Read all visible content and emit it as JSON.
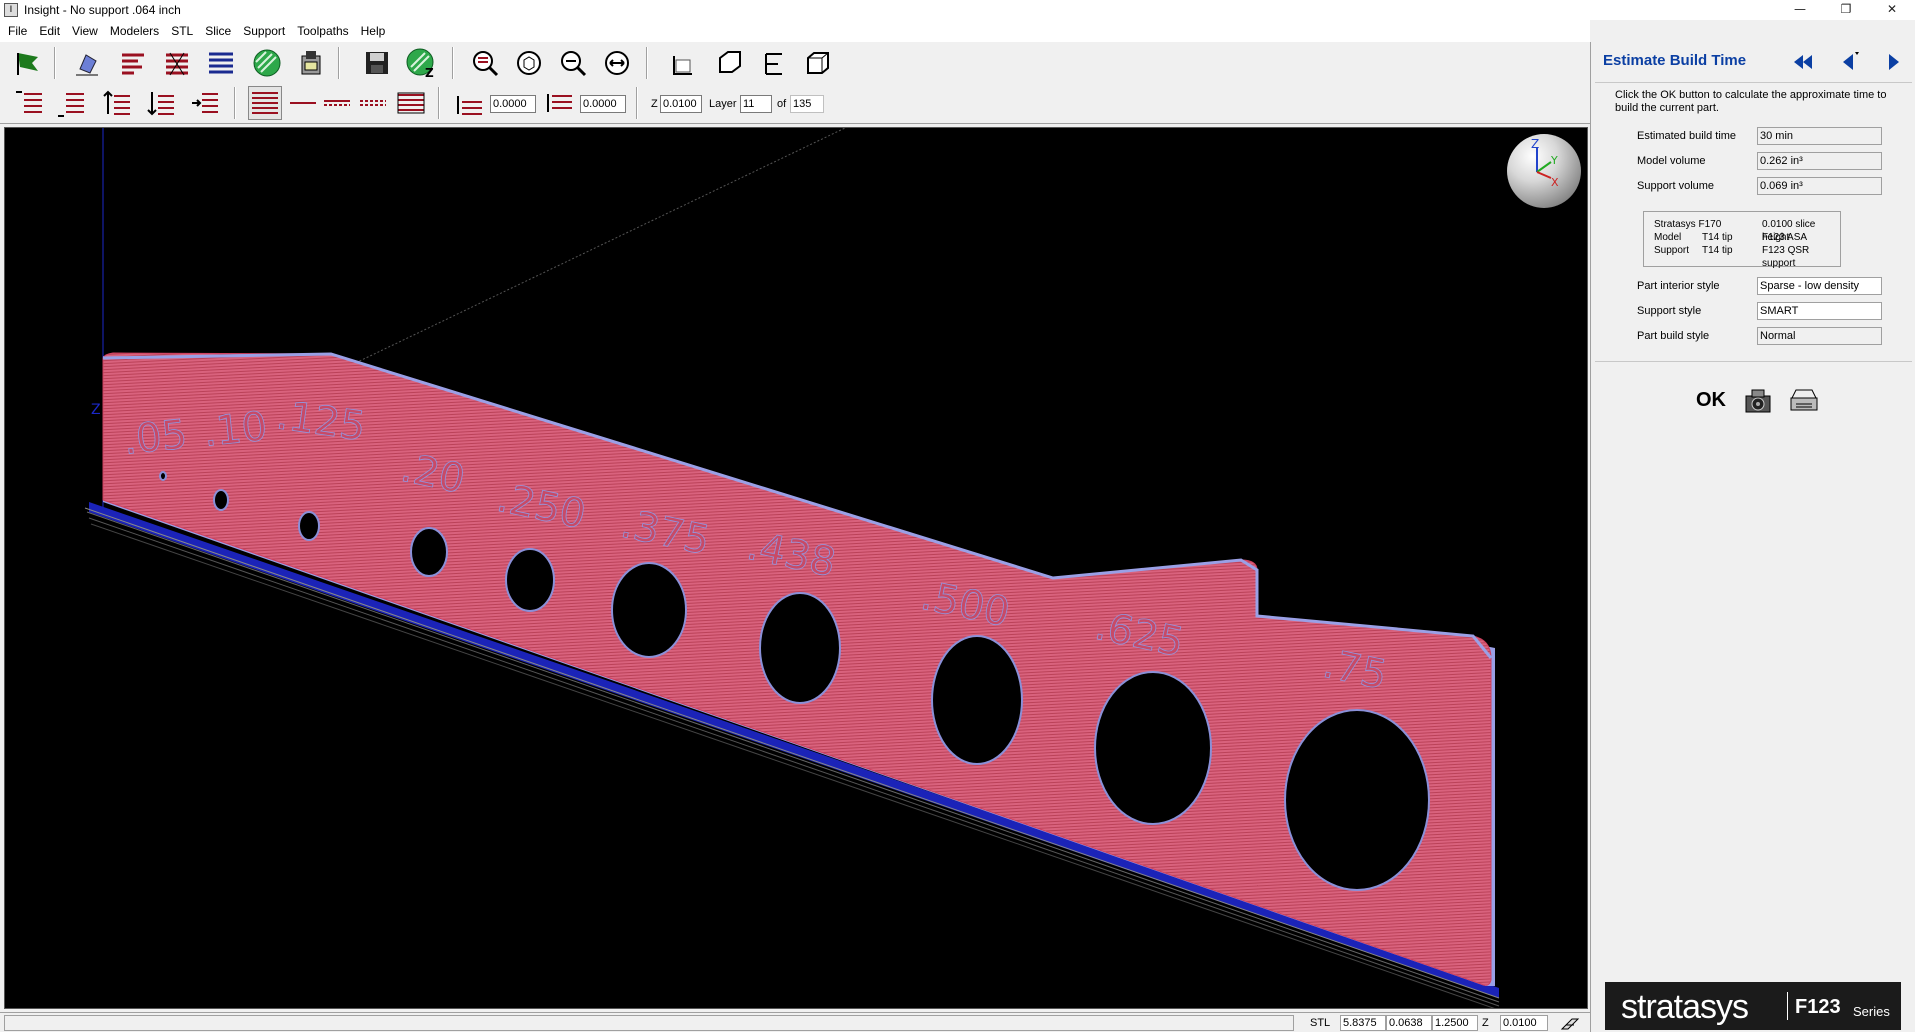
{
  "window": {
    "title": "Insight - No support .064 inch",
    "app_icon": "I",
    "controls": [
      "—",
      "❐",
      "✕"
    ]
  },
  "menu": [
    "File",
    "Edit",
    "View",
    "Modelers",
    "STL",
    "Slice",
    "Support",
    "Toolpaths",
    "Help"
  ],
  "toolbar2": {
    "offset1_value": "0.0000",
    "offset2_value": "0.0000",
    "z_label": "Z",
    "z_value": "0.0100",
    "layer_label": "Layer",
    "layer_value": "11",
    "of_label": "of",
    "of_value": "135"
  },
  "viewport": {
    "background": "#000000",
    "part_color": "#d9627d",
    "edge_color": "#8f96e0",
    "hole_labels": [
      ".05",
      ".10",
      ".125",
      ".20",
      ".250",
      ".375",
      ".438",
      ".500",
      ".625",
      ".75"
    ],
    "axis_labels": {
      "z": "Z",
      "y": "Y",
      "x": "X"
    }
  },
  "statusbar": {
    "stl_label": "STL",
    "dim_x": "5.8375",
    "dim_y": "0.0638",
    "dim_z": "1.2500",
    "z_label": "Z",
    "z_value": "0.0100"
  },
  "panel": {
    "title": "Estimate Build Time",
    "description": "Click the OK button to calculate the approximate time to build the current part.",
    "fields": [
      {
        "label": "Estimated build time",
        "value": "30 min"
      },
      {
        "label": "Model volume",
        "value": "0.262 in³"
      },
      {
        "label": "Support volume",
        "value": "0.069 in³"
      }
    ],
    "machine": {
      "printer": "Stratasys F170",
      "slice_height": "0.0100 slice height",
      "model_label": "Model",
      "model_tip": "T14 tip",
      "model_material": "F123 ASA",
      "support_label": "Support",
      "support_tip": "T14 tip",
      "support_material": "F123 QSR support"
    },
    "styles": [
      {
        "label": "Part interior style",
        "value": "Sparse - low density"
      },
      {
        "label": "Support style",
        "value": "SMART"
      },
      {
        "label": "Part build style",
        "value": "Normal"
      }
    ],
    "ok_label": "OK",
    "accent_color": "#0b3fa3"
  },
  "logo": {
    "brand": "stratasys",
    "model": "F123",
    "series": "Series"
  }
}
